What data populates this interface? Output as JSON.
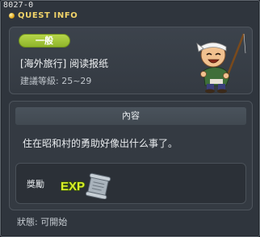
{
  "window": {
    "id_label": "8027-0",
    "title": "QUEST INFO"
  },
  "quest": {
    "category": "一般",
    "name": "[海外旅行] 阅读报纸",
    "level_text": "建議等級: 25~29"
  },
  "content": {
    "header": "內容",
    "text": "住在昭和村的勇助好像出什么事了。"
  },
  "reward": {
    "label": "獎勵",
    "exp_text": "EXP"
  },
  "status": {
    "text": "狀態: 可開始"
  },
  "icons": [
    "quest-title-icon",
    "npc-fisherman-portrait",
    "exp-reward-icon"
  ],
  "colors": {
    "title": "#f2d46a",
    "category_pill": "#9cc437",
    "window_bg": "#2f353d",
    "panel_bg": "#343a42"
  }
}
